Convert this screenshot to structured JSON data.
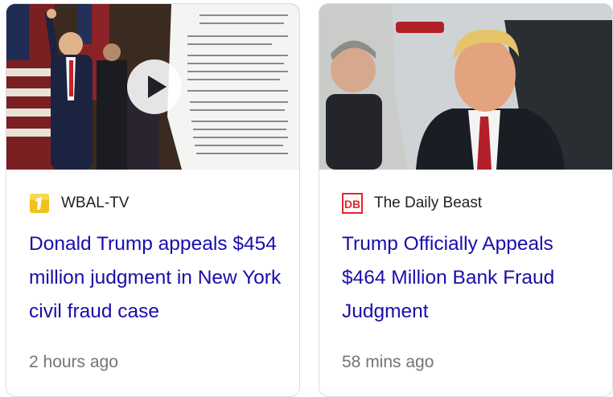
{
  "cards": [
    {
      "source": "WBAL-TV",
      "title": "Donald Trump appeals $454 million judgment in New York civil fraud case",
      "time": "2 hours ago",
      "has_video": true,
      "source_icon": "wbal-tv-logo-icon"
    },
    {
      "source": "The Daily Beast",
      "source_logo_text": "DB",
      "title": "Trump Officially Appeals $464 Million Bank Fraud Judgment",
      "time": "58 mins ago",
      "has_video": false,
      "source_icon": "daily-beast-logo-icon"
    }
  ],
  "colors": {
    "title_link": "#1a0dab",
    "meta_text": "#70757a",
    "daily_beast_red": "#e4252b"
  }
}
